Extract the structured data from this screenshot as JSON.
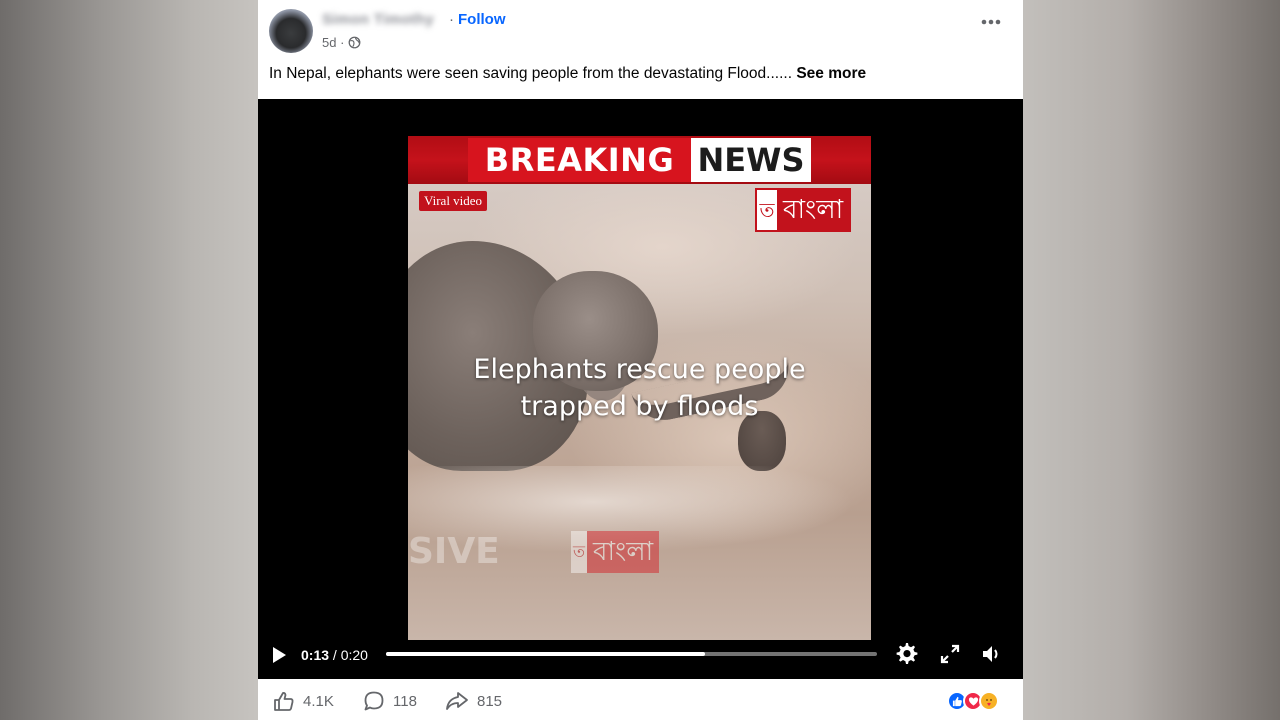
{
  "post": {
    "author_name": "Simon Timothy",
    "follow_separator": "·",
    "follow_label": "Follow",
    "timestamp": "5d ·",
    "privacy_icon": "globe-icon",
    "more_icon": "more-options-icon",
    "caption_text": "In Nepal, elephants were seen saving people from the devastating Flood......",
    "see_more_label": "See more"
  },
  "video": {
    "banner_breaking": "BREAKING",
    "banner_news": "NEWS",
    "tag_label": "Viral video",
    "channel_logo_mark": "ত",
    "channel_logo_word": "বাংলা",
    "overlay_line1": "Elephants rescue people",
    "overlay_line2": "trapped by floods",
    "watermark_text": "SIVE",
    "watermark_logo_word": "বাংলা",
    "current_time": "0:13",
    "total_time": " / 0:20",
    "progress_fraction": 0.65,
    "icons": [
      "play-icon",
      "settings-icon",
      "fullscreen-icon",
      "volume-icon"
    ]
  },
  "engagement": {
    "likes": "4.1K",
    "comments": "118",
    "shares": "815",
    "reaction_icons": [
      "like-reaction-icon",
      "love-reaction-icon",
      "care-reaction-icon"
    ]
  },
  "colors": {
    "accent": "#0866ff",
    "banner_red": "#c5121b",
    "muted_text": "#65676b"
  }
}
